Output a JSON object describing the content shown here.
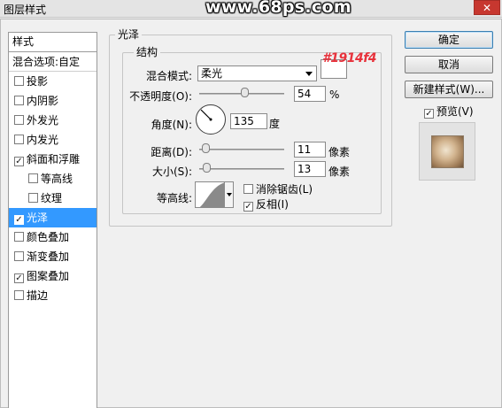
{
  "window": {
    "title": "图层样式",
    "watermark": "www.68ps.com",
    "close_label": "✕"
  },
  "style_list": {
    "header": "样式",
    "blend_options": "混合选项:自定",
    "items": [
      {
        "label": "投影",
        "checked": false
      },
      {
        "label": "内阴影",
        "checked": false
      },
      {
        "label": "外发光",
        "checked": false
      },
      {
        "label": "内发光",
        "checked": false
      },
      {
        "label": "斜面和浮雕",
        "checked": true
      },
      {
        "label": "等高线",
        "checked": false
      },
      {
        "label": "纹理",
        "checked": false
      },
      {
        "label": "光泽",
        "checked": true
      },
      {
        "label": "颜色叠加",
        "checked": false
      },
      {
        "label": "渐变叠加",
        "checked": false
      },
      {
        "label": "图案叠加",
        "checked": true
      },
      {
        "label": "描边",
        "checked": false
      }
    ]
  },
  "panel": {
    "section_title": "光泽",
    "group_title": "结构",
    "blend_mode_label": "混合模式:",
    "blend_mode_value": "柔光",
    "color_hex": "#1914f4",
    "color_value": "#ffffff",
    "opacity_label": "不透明度(O):",
    "opacity_value": "54",
    "opacity_unit": "%",
    "angle_label": "角度(N):",
    "angle_value": "135",
    "angle_unit": "度",
    "distance_label": "距离(D):",
    "distance_value": "11",
    "distance_unit": "像素",
    "size_label": "大小(S):",
    "size_value": "13",
    "size_unit": "像素",
    "contour_label": "等高线:",
    "anti_alias_label": "消除锯齿(L)",
    "anti_alias_checked": false,
    "invert_label": "反相(I)",
    "invert_checked": true
  },
  "buttons": {
    "ok": "确定",
    "cancel": "取消",
    "new_style": "新建样式(W)...",
    "preview_label": "预览(V)",
    "preview_checked": true
  },
  "check_mark": "✓"
}
